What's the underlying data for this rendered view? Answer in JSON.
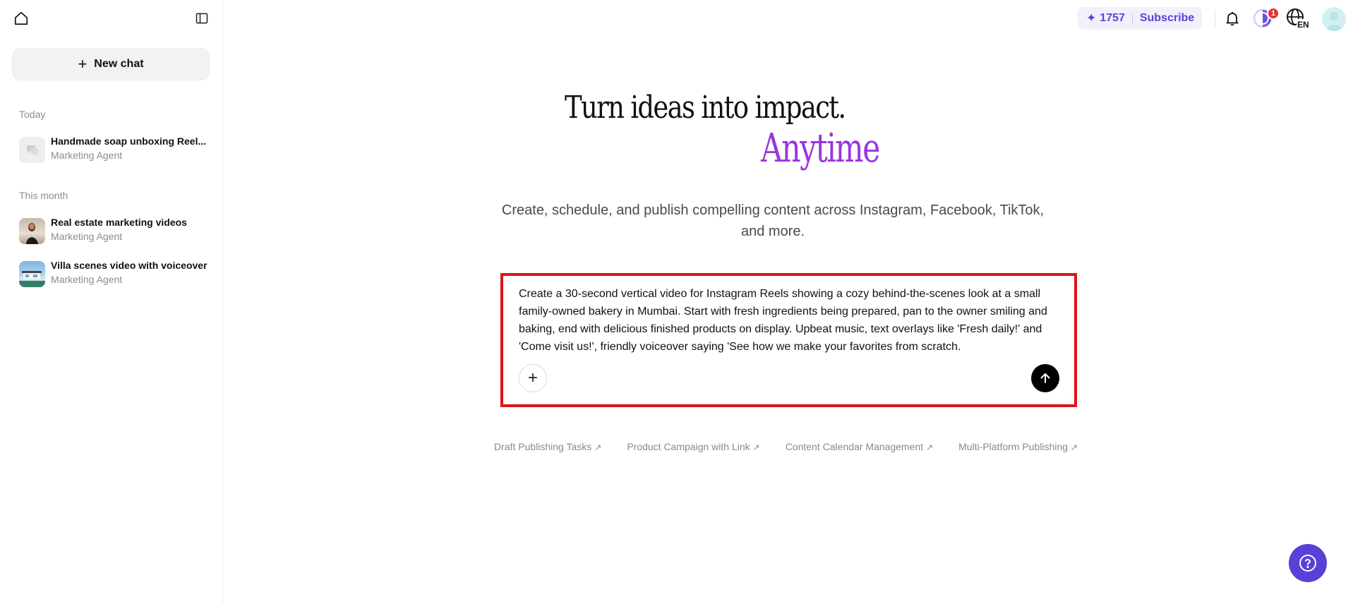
{
  "sidebar": {
    "new_chat_label": "New chat",
    "sections": [
      {
        "label": "Today"
      },
      {
        "label": "This month"
      }
    ],
    "items": [
      {
        "title": "Handmade soap unboxing Reel...",
        "subtitle": "Marketing Agent",
        "thumb": "chat-bubble-icon"
      },
      {
        "title": "Real estate marketing videos",
        "subtitle": "Marketing Agent",
        "thumb": "person-photo"
      },
      {
        "title": "Villa scenes video with voiceover",
        "subtitle": "Marketing Agent",
        "thumb": "villa-photo"
      }
    ]
  },
  "topbar": {
    "credits": "1757",
    "subscribe_label": "Subscribe",
    "notifications_badge": "1",
    "language": "EN",
    "accent_color": "#5b43d6"
  },
  "hero": {
    "line1": "Turn ideas into impact.",
    "line2": "Anytime",
    "subtitle": "Create, schedule, and publish compelling content across Instagram, Facebook, TikTok, and more.",
    "accent_color": "#9a35e0"
  },
  "composer": {
    "prompt_text": "Create a 30-second vertical video for Instagram Reels showing a cozy behind-the-scenes look at a small family-owned bakery in Mumbai. Start with fresh ingredients being prepared, pan to the owner smiling and baking, end with delicious finished products on display. Upbeat music, text overlays like 'Fresh daily!' and 'Come visit us!', friendly voiceover saying 'See how we make your favorites from scratch.",
    "attach_icon": "plus-icon",
    "send_icon": "arrow-up-icon"
  },
  "suggestions": [
    {
      "label": "Draft Publishing Tasks",
      "arrow": "↗"
    },
    {
      "label": "Product Campaign with Link",
      "arrow": "↗"
    },
    {
      "label": "Content Calendar Management",
      "arrow": "↗"
    },
    {
      "label": "Multi-Platform Publishing",
      "arrow": "↗"
    }
  ],
  "help": {
    "icon": "question-icon"
  }
}
